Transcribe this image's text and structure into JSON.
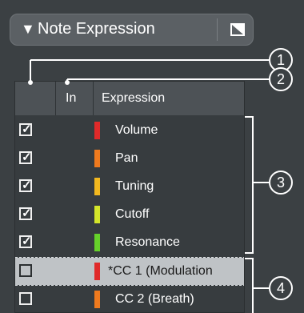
{
  "panel": {
    "title": "Note Expression",
    "collapse_arrow": "▼"
  },
  "table": {
    "headers": {
      "enable": "",
      "in": "In",
      "expression": "Expression"
    },
    "rows": [
      {
        "label": "Volume",
        "checked": true,
        "color": "#e02a2a"
      },
      {
        "label": "Pan",
        "checked": true,
        "color": "#ef7a1e"
      },
      {
        "label": "Tuning",
        "checked": true,
        "color": "#f2b81f"
      },
      {
        "label": "Cutoff",
        "checked": true,
        "color": "#d4e62a"
      },
      {
        "label": "Resonance",
        "checked": true,
        "color": "#66d12a"
      },
      {
        "label": "*CC 1  (Modulation",
        "checked": false,
        "color": "#e02a2a",
        "selected": true
      },
      {
        "label": "CC 2  (Breath)",
        "checked": false,
        "color": "#ef7a1e"
      }
    ]
  },
  "callouts": [
    "1",
    "2",
    "3",
    "4"
  ],
  "colors": {
    "accent": "#fff",
    "background": "#3b4043"
  }
}
